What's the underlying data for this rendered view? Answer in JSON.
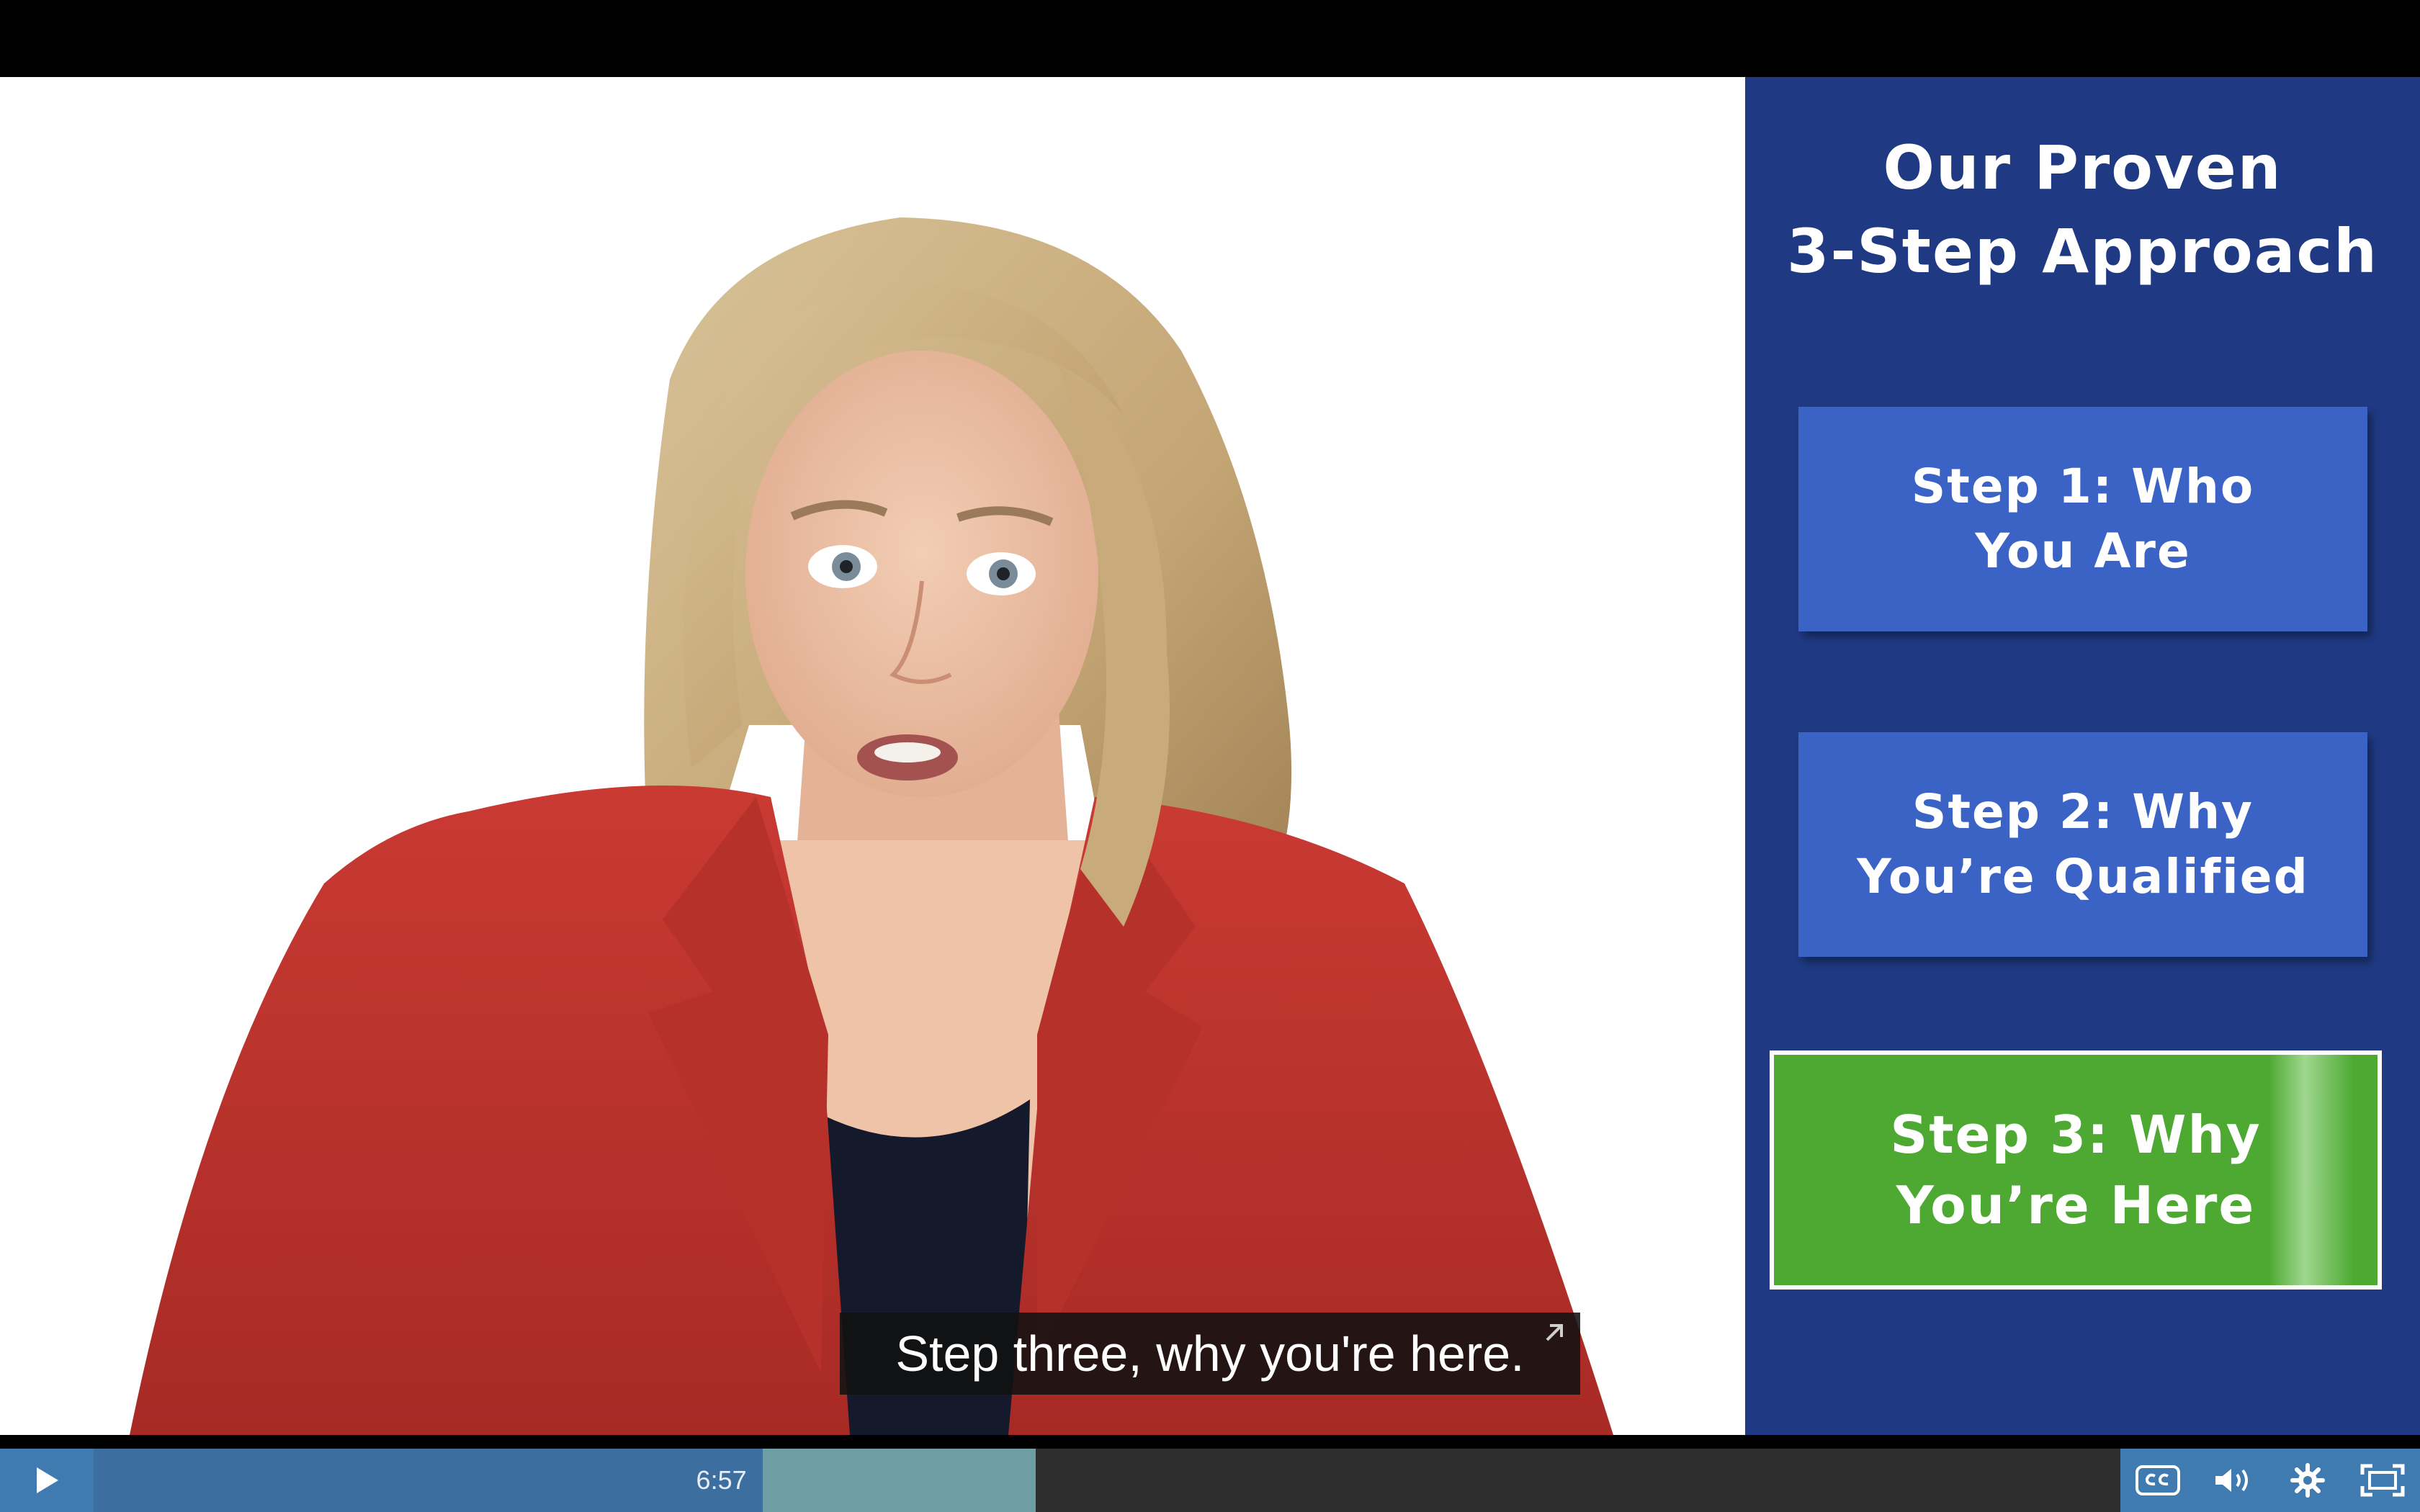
{
  "panel": {
    "title_line1": "Our Proven",
    "title_line2": "3-Step Approach",
    "steps": [
      {
        "line1": "Step 1: Who",
        "line2": "You Are"
      },
      {
        "line1": "Step 2: Why",
        "line2": "You’re Qualified"
      },
      {
        "line1": "Step 3: Why",
        "line2": "You’re Here"
      }
    ]
  },
  "caption": {
    "text": "Step three, why you're here."
  },
  "player": {
    "time": "6:57",
    "progress": 0.33,
    "buffered_end": 0.465,
    "icons": [
      "play-icon",
      "cc-icon",
      "volume-icon",
      "settings-icon",
      "fullscreen-icon"
    ],
    "colors": {
      "accent": "#3f7ab0",
      "played": "#3c6fa0",
      "buffered": "#6e9ea3",
      "panel": "#1f3a83",
      "step": "#3a63c5",
      "active_step": "#4ea933"
    }
  }
}
